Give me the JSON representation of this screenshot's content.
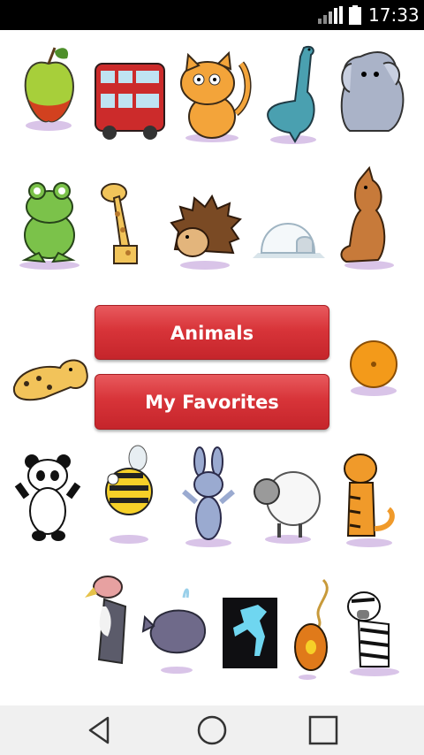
{
  "status_bar": {
    "time": "17:33",
    "icons": [
      "signal-icon",
      "battery-icon"
    ]
  },
  "grid": {
    "rows": [
      [
        "apple",
        "double-decker-bus",
        "cat",
        "dinosaur",
        "elephant"
      ],
      [
        "frog",
        "giraffe",
        "hedgehog",
        "igloo",
        "kangaroo"
      ],
      [
        "leopard",
        "",
        "",
        "",
        "orange"
      ],
      [
        "panda",
        "bee",
        "rabbit",
        "sheep",
        "tiger"
      ],
      [
        "vulture",
        "whale",
        "x-ray-dinosaur",
        "yo-yo",
        "zebra"
      ]
    ]
  },
  "menu": {
    "animals_label": "Animals",
    "favorites_label": "My Favorites"
  },
  "nav_bar": {
    "icons": [
      "back-icon",
      "home-icon",
      "recents-icon"
    ]
  },
  "colors": {
    "button_red": "#d83439",
    "status_bar": "#000000",
    "nav_bar": "#f0f0f0"
  }
}
